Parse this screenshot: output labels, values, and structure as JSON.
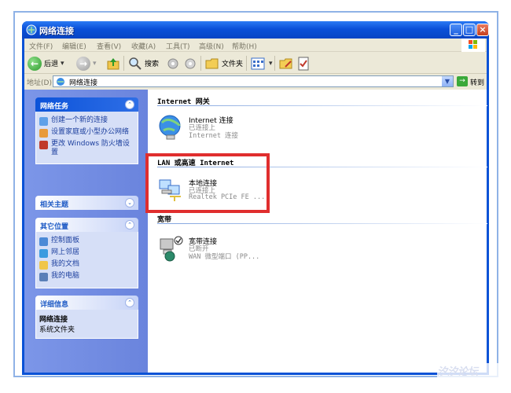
{
  "window": {
    "title": "网络连接"
  },
  "menu": [
    "文件(F)",
    "编辑(E)",
    "查看(V)",
    "收藏(A)",
    "工具(T)",
    "高级(N)",
    "帮助(H)"
  ],
  "toolbar": {
    "back": "后退",
    "search": "搜索",
    "folders": "文件夹"
  },
  "address": {
    "label": "地址(D)",
    "value": "网络连接",
    "go": "转到"
  },
  "tasks": {
    "network": {
      "title": "网络任务",
      "items": [
        "创建一个新的连接",
        "设置家庭或小型办公网络",
        "更改 Windows 防火墙设置"
      ]
    },
    "related": {
      "title": "相关主题"
    },
    "other": {
      "title": "其它位置",
      "items": [
        "控制面板",
        "网上邻居",
        "我的文档",
        "我的电脑"
      ]
    },
    "details": {
      "title": "详细信息",
      "name": "网络连接",
      "type": "系统文件夹"
    }
  },
  "groups": {
    "internet": "Internet 网关",
    "lan": "LAN 或高速 Internet",
    "broadband": "宽带"
  },
  "connections": {
    "inet": {
      "name": "Internet 连接",
      "status": "已连接上",
      "device": "Internet 连接"
    },
    "local": {
      "name": "本地连接",
      "status": "已连接上",
      "device": "Realtek PCIe FE ..."
    },
    "broadband": {
      "name": "宽带连接",
      "status": "已断开",
      "device": "WAN 微型端口 (PP..."
    }
  },
  "colors": {
    "highlight": "#e02e2e",
    "title_bar": "#0a50d8",
    "task_pane": "#7c96e8"
  },
  "watermark": "汐汐论坛"
}
